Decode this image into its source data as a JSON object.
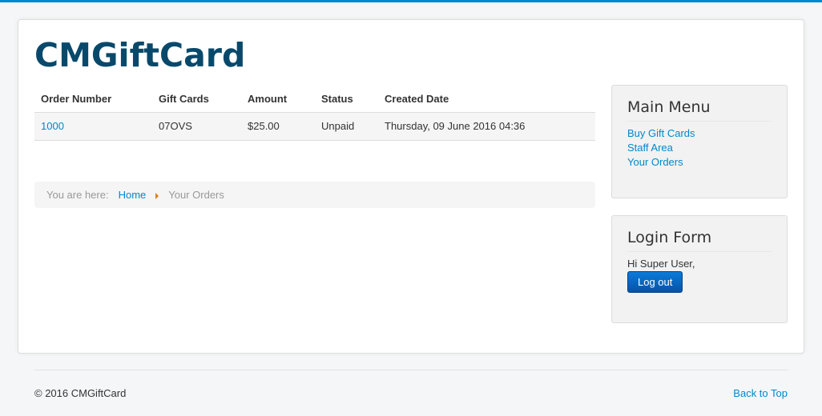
{
  "site": {
    "title": "CMGiftCard"
  },
  "orders": {
    "columns": [
      "Order Number",
      "Gift Cards",
      "Amount",
      "Status",
      "Created Date"
    ],
    "rows": [
      {
        "order_number": "1000",
        "gift_cards": "07OVS",
        "amount": "$25.00",
        "status": "Unpaid",
        "created_date": "Thursday, 09 June 2016 04:36"
      }
    ]
  },
  "breadcrumb": {
    "label": "You are here:",
    "home": "Home",
    "current": "Your Orders"
  },
  "main_menu": {
    "title": "Main Menu",
    "items": [
      "Buy Gift Cards",
      "Staff Area",
      "Your Orders"
    ]
  },
  "login_form": {
    "title": "Login Form",
    "greeting": "Hi Super User,",
    "logout_label": "Log out"
  },
  "footer": {
    "copyright": "© 2016 CMGiftCard",
    "back_to_top": "Back to Top"
  },
  "colors": {
    "accent": "#0088cc",
    "brand": "#08496b",
    "divider_arrow": "#e07f1a",
    "button": "#0553a8"
  }
}
